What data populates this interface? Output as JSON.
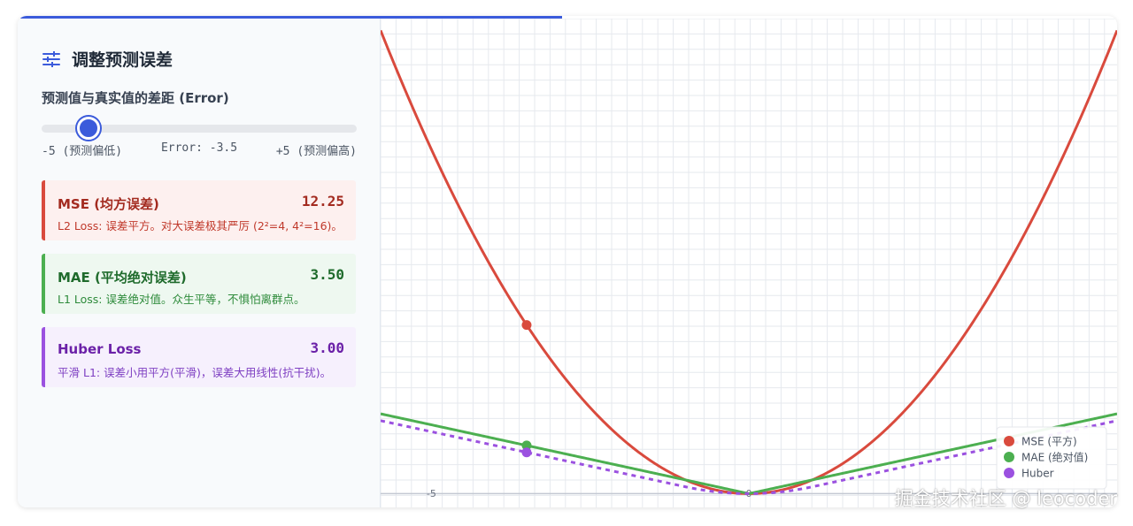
{
  "panel": {
    "title": "调整预测误差",
    "slider_label": "预测值与真实值的差距 (Error)",
    "slider": {
      "min": -5,
      "max": 5,
      "value": -3.5
    },
    "scale_left": "-5 (预测偏低)",
    "scale_mid": "Error: -3.5",
    "scale_right": "+5 (预测偏高)"
  },
  "metrics": {
    "mse": {
      "name": "MSE (均方误差)",
      "value": "12.25",
      "desc": "L2 Loss: 误差平方。对大误差极其严厉 (2²=4, 4²=16)。"
    },
    "mae": {
      "name": "MAE (平均绝对误差)",
      "value": "3.50",
      "desc": "L1 Loss: 误差绝对值。众生平等，不惧怕离群点。"
    },
    "huber": {
      "name": "Huber Loss",
      "value": "3.00",
      "desc": "平滑 L1: 误差小用平方(平滑)，误差大用线性(抗干扰)。"
    }
  },
  "colors": {
    "mse": "#d94a3d",
    "mae": "#4caf50",
    "huber": "#9b51e0",
    "accent": "#3b5bdb"
  },
  "chart_data": {
    "type": "line",
    "x_range": [
      -5.8,
      5.8
    ],
    "y_range": [
      -1.0,
      34.5
    ],
    "xticks": [
      -5,
      0
    ],
    "grid": true,
    "legend_position": "bottom-right",
    "current_error": -3.5,
    "series": [
      {
        "name": "MSE (平方)",
        "function": "x^2",
        "color": "#d94a3d",
        "style": "solid",
        "current_point": [
          -3.5,
          12.25
        ]
      },
      {
        "name": "MAE (绝对值)",
        "function": "|x|",
        "color": "#4caf50",
        "style": "solid",
        "current_point": [
          -3.5,
          3.5
        ]
      },
      {
        "name": "Huber",
        "function": "huber(delta=1)",
        "color": "#9b51e0",
        "style": "dashed",
        "current_point": [
          -3.5,
          3.0
        ]
      }
    ]
  },
  "watermark": "掘金技术社区 @ leocoder"
}
